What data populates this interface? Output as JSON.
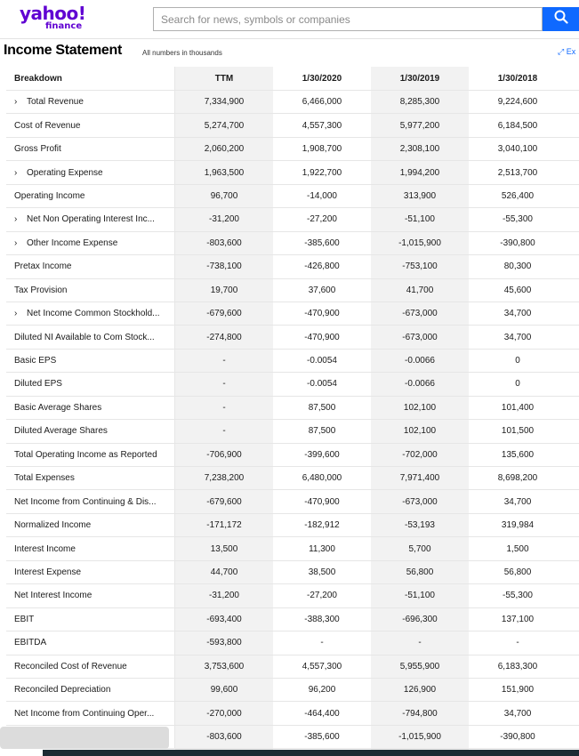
{
  "logo": {
    "main": "yahoo!",
    "sub": "finance"
  },
  "search": {
    "placeholder": "Search for news, symbols or companies"
  },
  "page": {
    "title": "Income Statement",
    "units_note": "All numbers in thousands",
    "expand_label": "Ex"
  },
  "table": {
    "headers": [
      "Breakdown",
      "TTM",
      "1/30/2020",
      "1/30/2019",
      "1/30/2018"
    ],
    "rows": [
      {
        "label": "Total Revenue",
        "expandable": "›",
        "values": [
          "7,334,900",
          "6,466,000",
          "8,285,300",
          "9,224,600"
        ]
      },
      {
        "label": "Cost of Revenue",
        "expandable": "",
        "values": [
          "5,274,700",
          "4,557,300",
          "5,977,200",
          "6,184,500"
        ]
      },
      {
        "label": "Gross Profit",
        "expandable": "",
        "values": [
          "2,060,200",
          "1,908,700",
          "2,308,100",
          "3,040,100"
        ]
      },
      {
        "label": "Operating Expense",
        "expandable": "›",
        "values": [
          "1,963,500",
          "1,922,700",
          "1,994,200",
          "2,513,700"
        ]
      },
      {
        "label": "Operating Income",
        "expandable": "",
        "values": [
          "96,700",
          "-14,000",
          "313,900",
          "526,400"
        ]
      },
      {
        "label": "Net Non Operating Interest Inc...",
        "expandable": "›",
        "values": [
          "-31,200",
          "-27,200",
          "-51,100",
          "-55,300"
        ]
      },
      {
        "label": "Other Income Expense",
        "expandable": "›",
        "values": [
          "-803,600",
          "-385,600",
          "-1,015,900",
          "-390,800"
        ]
      },
      {
        "label": "Pretax Income",
        "expandable": "",
        "values": [
          "-738,100",
          "-426,800",
          "-753,100",
          "80,300"
        ]
      },
      {
        "label": "Tax Provision",
        "expandable": "",
        "values": [
          "19,700",
          "37,600",
          "41,700",
          "45,600"
        ]
      },
      {
        "label": "Net Income Common Stockhold...",
        "expandable": "›",
        "values": [
          "-679,600",
          "-470,900",
          "-673,000",
          "34,700"
        ]
      },
      {
        "label": "Diluted NI Available to Com Stock...",
        "expandable": "",
        "values": [
          "-274,800",
          "-470,900",
          "-673,000",
          "34,700"
        ]
      },
      {
        "label": "Basic EPS",
        "expandable": "",
        "values": [
          "-",
          "-0.0054",
          "-0.0066",
          "0"
        ]
      },
      {
        "label": "Diluted EPS",
        "expandable": "",
        "values": [
          "-",
          "-0.0054",
          "-0.0066",
          "0"
        ]
      },
      {
        "label": "Basic Average Shares",
        "expandable": "",
        "values": [
          "-",
          "87,500",
          "102,100",
          "101,400"
        ]
      },
      {
        "label": "Diluted Average Shares",
        "expandable": "",
        "values": [
          "-",
          "87,500",
          "102,100",
          "101,500"
        ]
      },
      {
        "label": "Total Operating Income as Reported",
        "expandable": "",
        "values": [
          "-706,900",
          "-399,600",
          "-702,000",
          "135,600"
        ]
      },
      {
        "label": "Total Expenses",
        "expandable": "",
        "values": [
          "7,238,200",
          "6,480,000",
          "7,971,400",
          "8,698,200"
        ]
      },
      {
        "label": "Net Income from Continuing & Dis...",
        "expandable": "",
        "values": [
          "-679,600",
          "-470,900",
          "-673,000",
          "34,700"
        ]
      },
      {
        "label": "Normalized Income",
        "expandable": "",
        "values": [
          "-171,172",
          "-182,912",
          "-53,193",
          "319,984"
        ]
      },
      {
        "label": "Interest Income",
        "expandable": "",
        "values": [
          "13,500",
          "11,300",
          "5,700",
          "1,500"
        ]
      },
      {
        "label": "Interest Expense",
        "expandable": "",
        "values": [
          "44,700",
          "38,500",
          "56,800",
          "56,800"
        ]
      },
      {
        "label": "Net Interest Income",
        "expandable": "",
        "values": [
          "-31,200",
          "-27,200",
          "-51,100",
          "-55,300"
        ]
      },
      {
        "label": "EBIT",
        "expandable": "",
        "values": [
          "-693,400",
          "-388,300",
          "-696,300",
          "137,100"
        ]
      },
      {
        "label": "EBITDA",
        "expandable": "",
        "values": [
          "-593,800",
          "-",
          "-",
          "-"
        ]
      },
      {
        "label": "Reconciled Cost of Revenue",
        "expandable": "",
        "values": [
          "3,753,600",
          "4,557,300",
          "5,955,900",
          "6,183,300"
        ]
      },
      {
        "label": "Reconciled Depreciation",
        "expandable": "",
        "values": [
          "99,600",
          "96,200",
          "126,900",
          "151,900"
        ]
      },
      {
        "label": "Net Income from Continuing Oper...",
        "expandable": "",
        "values": [
          "-270,000",
          "-464,400",
          "-794,800",
          "34,700"
        ]
      },
      {
        "label": "",
        "expandable": "",
        "values": [
          "-803,600",
          "-385,600",
          "-1,015,900",
          "-390,800"
        ]
      }
    ]
  },
  "colors": {
    "brand": "#6001d2",
    "accent": "#0f69ff",
    "shaded_column": "#f2f2f2"
  },
  "icons": {
    "search": "search-icon",
    "expand": "expand-arrow-icon"
  }
}
